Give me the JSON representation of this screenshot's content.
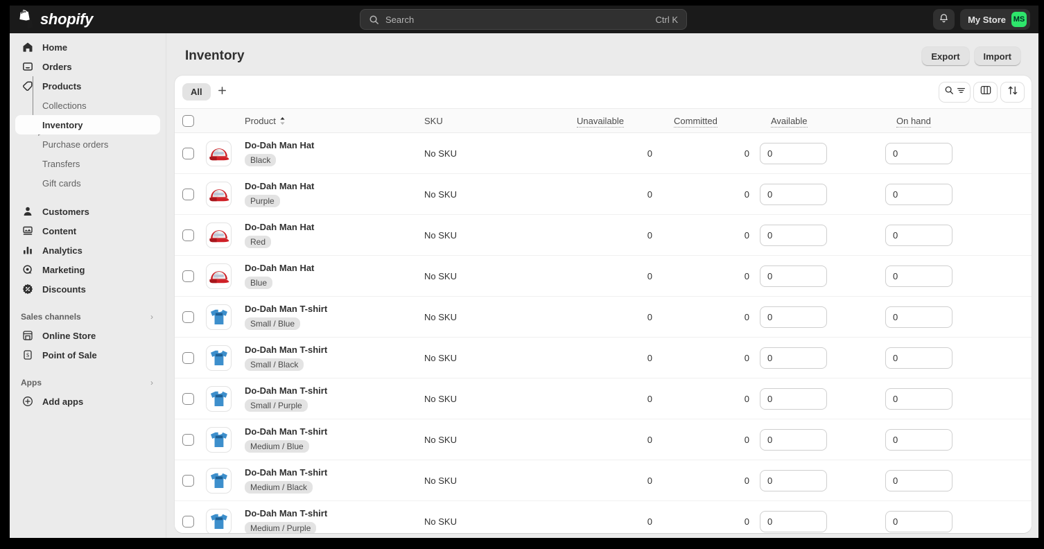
{
  "topbar": {
    "brand_name": "shopify",
    "brand_logo_icon": "shopify-bag-icon",
    "search": {
      "placeholder": "Search",
      "shortcut": "Ctrl K",
      "icon": "search-icon"
    },
    "notifications_icon": "bell-icon",
    "store_name": "My Store",
    "avatar_initials": "MS",
    "avatar_color": "#2ee56b"
  },
  "sidebar": {
    "items": [
      {
        "label": "Home",
        "icon": "home-icon"
      },
      {
        "label": "Orders",
        "icon": "orders-inbox-icon"
      },
      {
        "label": "Products",
        "icon": "products-tag-icon"
      }
    ],
    "product_subitems": [
      {
        "label": "Collections",
        "active": false
      },
      {
        "label": "Inventory",
        "active": true
      },
      {
        "label": "Purchase orders",
        "active": false
      },
      {
        "label": "Transfers",
        "active": false
      },
      {
        "label": "Gift cards",
        "active": false
      }
    ],
    "items2": [
      {
        "label": "Customers",
        "icon": "customer-person-icon"
      },
      {
        "label": "Content",
        "icon": "content-media-icon"
      },
      {
        "label": "Analytics",
        "icon": "analytics-bars-icon"
      },
      {
        "label": "Marketing",
        "icon": "marketing-target-icon"
      },
      {
        "label": "Discounts",
        "icon": "discounts-badge-icon"
      }
    ],
    "sales_channels": {
      "label": "Sales channels",
      "chevron_icon": "chevron-right-icon",
      "items": [
        {
          "label": "Online Store",
          "icon": "storefront-icon"
        },
        {
          "label": "Point of Sale",
          "icon": "pos-receipt-icon"
        }
      ]
    },
    "apps": {
      "label": "Apps",
      "chevron_icon": "chevron-right-icon",
      "items": [
        {
          "label": "Add apps",
          "icon": "plus-circle-icon"
        }
      ]
    }
  },
  "page": {
    "title": "Inventory",
    "export_label": "Export",
    "import_label": "Import"
  },
  "toolbar": {
    "tabs": [
      {
        "label": "All",
        "active": true
      }
    ],
    "add_tab_icon": "plus-icon",
    "search_filter_icon": "search-filter-icon",
    "columns_icon": "columns-icon",
    "sort_icon": "sort-arrows-icon"
  },
  "table": {
    "headers": {
      "select_all": "select-all-checkbox",
      "product": "Product",
      "product_sort_icon": "sort-chevrons-icon",
      "sku": "SKU",
      "unavailable": "Unavailable",
      "committed": "Committed",
      "available": "Available",
      "on_hand": "On hand"
    },
    "rows": [
      {
        "product": "Do-Dah Man Hat",
        "variant": "Black",
        "thumb": "red-trucker-hat-icon",
        "sku": "No SKU",
        "unavailable": "0",
        "committed": "0",
        "available": "0",
        "on_hand": "0"
      },
      {
        "product": "Do-Dah Man Hat",
        "variant": "Purple",
        "thumb": "red-trucker-hat-icon",
        "sku": "No SKU",
        "unavailable": "0",
        "committed": "0",
        "available": "0",
        "on_hand": "0"
      },
      {
        "product": "Do-Dah Man Hat",
        "variant": "Red",
        "thumb": "red-trucker-hat-icon",
        "sku": "No SKU",
        "unavailable": "0",
        "committed": "0",
        "available": "0",
        "on_hand": "0"
      },
      {
        "product": "Do-Dah Man Hat",
        "variant": "Blue",
        "thumb": "red-trucker-hat-icon",
        "sku": "No SKU",
        "unavailable": "0",
        "committed": "0",
        "available": "0",
        "on_hand": "0"
      },
      {
        "product": "Do-Dah Man T-shirt",
        "variant": "Small / Blue",
        "thumb": "blue-tshirt-icon",
        "sku": "No SKU",
        "unavailable": "0",
        "committed": "0",
        "available": "0",
        "on_hand": "0"
      },
      {
        "product": "Do-Dah Man T-shirt",
        "variant": "Small / Black",
        "thumb": "blue-tshirt-icon",
        "sku": "No SKU",
        "unavailable": "0",
        "committed": "0",
        "available": "0",
        "on_hand": "0"
      },
      {
        "product": "Do-Dah Man T-shirt",
        "variant": "Small / Purple",
        "thumb": "blue-tshirt-icon",
        "sku": "No SKU",
        "unavailable": "0",
        "committed": "0",
        "available": "0",
        "on_hand": "0"
      },
      {
        "product": "Do-Dah Man T-shirt",
        "variant": "Medium / Blue",
        "thumb": "blue-tshirt-icon",
        "sku": "No SKU",
        "unavailable": "0",
        "committed": "0",
        "available": "0",
        "on_hand": "0"
      },
      {
        "product": "Do-Dah Man T-shirt",
        "variant": "Medium / Black",
        "thumb": "blue-tshirt-icon",
        "sku": "No SKU",
        "unavailable": "0",
        "committed": "0",
        "available": "0",
        "on_hand": "0"
      },
      {
        "product": "Do-Dah Man T-shirt",
        "variant": "Medium / Purple",
        "thumb": "blue-tshirt-icon",
        "sku": "No SKU",
        "unavailable": "0",
        "committed": "0",
        "available": "0",
        "on_hand": "0"
      }
    ]
  }
}
